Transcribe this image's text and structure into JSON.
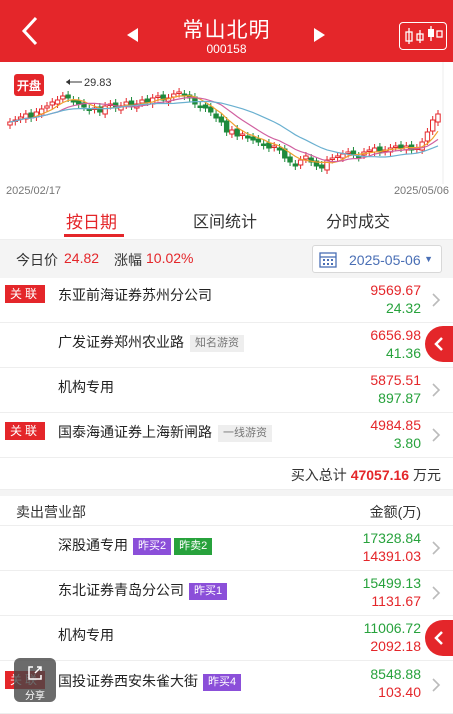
{
  "header": {
    "title": "常山北明",
    "code": "000158"
  },
  "chart": {
    "start_date": "2025/02/17",
    "end_date": "2025/05/06",
    "peak_label": "29.83",
    "open_badge": "开盘",
    "colors": {
      "up": "#e4262a",
      "down": "#1e8a3c",
      "ma5": "#f0a030",
      "ma10": "#d060a0",
      "ma20": "#6ab0d0"
    }
  },
  "tabs": [
    {
      "label": "按日期"
    },
    {
      "label": "区间统计"
    },
    {
      "label": "分时成交"
    }
  ],
  "summary": {
    "price_label": "今日价",
    "price_value": "24.82",
    "change_label": "涨幅",
    "change_value": "10.02%",
    "date": "2025-05-06"
  },
  "buy_rows": [
    {
      "tag": "关联",
      "name": "东亚前海证券苏州分公司",
      "badge": "",
      "buy": "9569.67",
      "sell": "24.32"
    },
    {
      "tag": "",
      "name": "广发证券郑州农业路",
      "badge": "知名游资",
      "buy": "6656.98",
      "sell": "41.36"
    },
    {
      "tag": "",
      "name": "机构专用",
      "badge": "",
      "buy": "5875.51",
      "sell": "897.87"
    },
    {
      "tag": "关联",
      "name": "国泰海通证券上海新闸路",
      "badge": "一线游资",
      "buy": "4984.85",
      "sell": "3.80"
    }
  ],
  "buy_total": {
    "label": "买入总计",
    "value": "47057.16",
    "unit": "万元"
  },
  "sell_header": {
    "left": "卖出营业部",
    "right": "金额(万)"
  },
  "sell_rows": [
    {
      "tag": "",
      "name": "深股通专用",
      "badge_purple": "昨买2",
      "badge_green": "昨卖2",
      "sell": "17328.84",
      "buy": "14391.03"
    },
    {
      "tag": "",
      "name": "东北证券青岛分公司",
      "badge_purple": "昨买1",
      "badge_green": "",
      "sell": "15499.13",
      "buy": "1131.67"
    },
    {
      "tag": "",
      "name": "机构专用",
      "badge_purple": "",
      "badge_green": "",
      "sell": "11006.72",
      "buy": "2092.18"
    },
    {
      "tag": "关联",
      "name": "国投证券西安朱雀大街",
      "badge_purple": "昨买4",
      "badge_green": "",
      "sell": "8548.88",
      "buy": "103.40"
    }
  ],
  "share": {
    "label": "分享"
  }
}
